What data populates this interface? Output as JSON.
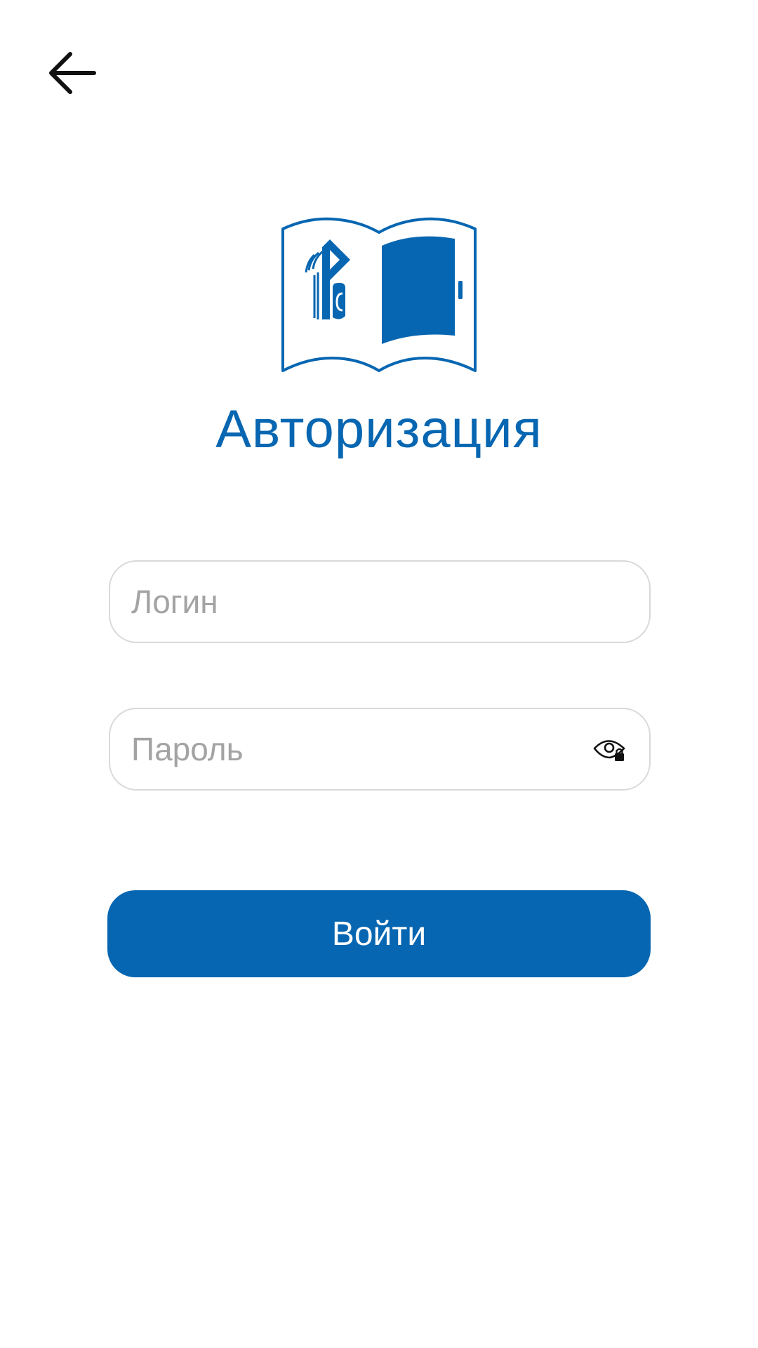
{
  "header": {
    "back_icon": "arrow-left-icon"
  },
  "branding": {
    "logo_icon": "book-door-logo-icon",
    "accent_color": "#0766b1"
  },
  "auth": {
    "title": "Авторизация",
    "login_placeholder": "Логин",
    "login_value": "",
    "password_placeholder": "Пароль",
    "password_value": "",
    "visibility_icon": "eye-lock-icon",
    "submit_label": "Войти"
  }
}
